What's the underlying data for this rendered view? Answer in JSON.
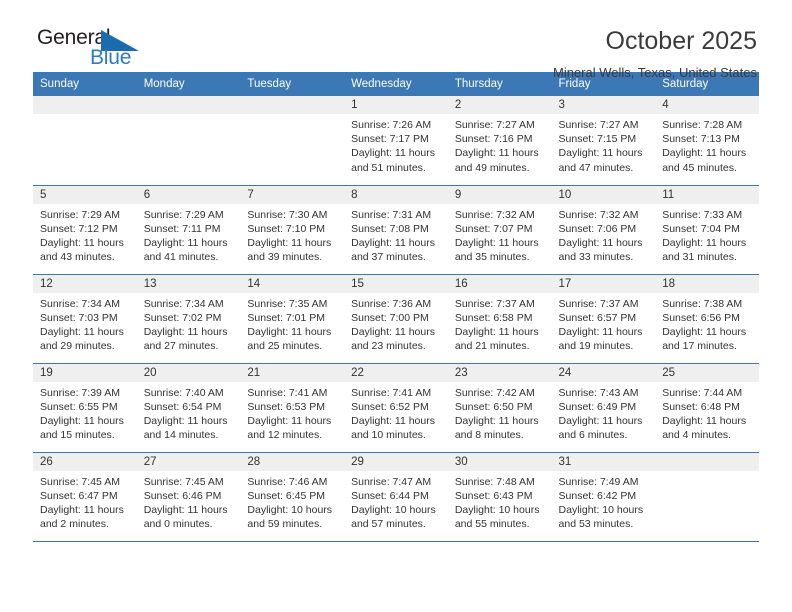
{
  "brand": {
    "name_part1": "General",
    "name_part2": "Blue",
    "triangle_color": "#1a6bb0",
    "text_color": "#231f20",
    "blue_color": "#2b7cc4"
  },
  "header": {
    "title": "October 2025",
    "subtitle": "Mineral Wells, Texas, United States",
    "accent_color": "#3b78b5",
    "daynum_band_color": "#efefef"
  },
  "weekdays": [
    "Sunday",
    "Monday",
    "Tuesday",
    "Wednesday",
    "Thursday",
    "Friday",
    "Saturday"
  ],
  "labels": {
    "sunrise": "Sunrise:",
    "sunset": "Sunset:",
    "daylight": "Daylight:"
  },
  "weeks": [
    [
      {
        "day": "",
        "sunrise": "",
        "sunset": "",
        "daylight": ""
      },
      {
        "day": "",
        "sunrise": "",
        "sunset": "",
        "daylight": ""
      },
      {
        "day": "",
        "sunrise": "",
        "sunset": "",
        "daylight": ""
      },
      {
        "day": "1",
        "sunrise": "Sunrise: 7:26 AM",
        "sunset": "Sunset: 7:17 PM",
        "daylight": "Daylight: 11 hours and 51 minutes."
      },
      {
        "day": "2",
        "sunrise": "Sunrise: 7:27 AM",
        "sunset": "Sunset: 7:16 PM",
        "daylight": "Daylight: 11 hours and 49 minutes."
      },
      {
        "day": "3",
        "sunrise": "Sunrise: 7:27 AM",
        "sunset": "Sunset: 7:15 PM",
        "daylight": "Daylight: 11 hours and 47 minutes."
      },
      {
        "day": "4",
        "sunrise": "Sunrise: 7:28 AM",
        "sunset": "Sunset: 7:13 PM",
        "daylight": "Daylight: 11 hours and 45 minutes."
      }
    ],
    [
      {
        "day": "5",
        "sunrise": "Sunrise: 7:29 AM",
        "sunset": "Sunset: 7:12 PM",
        "daylight": "Daylight: 11 hours and 43 minutes."
      },
      {
        "day": "6",
        "sunrise": "Sunrise: 7:29 AM",
        "sunset": "Sunset: 7:11 PM",
        "daylight": "Daylight: 11 hours and 41 minutes."
      },
      {
        "day": "7",
        "sunrise": "Sunrise: 7:30 AM",
        "sunset": "Sunset: 7:10 PM",
        "daylight": "Daylight: 11 hours and 39 minutes."
      },
      {
        "day": "8",
        "sunrise": "Sunrise: 7:31 AM",
        "sunset": "Sunset: 7:08 PM",
        "daylight": "Daylight: 11 hours and 37 minutes."
      },
      {
        "day": "9",
        "sunrise": "Sunrise: 7:32 AM",
        "sunset": "Sunset: 7:07 PM",
        "daylight": "Daylight: 11 hours and 35 minutes."
      },
      {
        "day": "10",
        "sunrise": "Sunrise: 7:32 AM",
        "sunset": "Sunset: 7:06 PM",
        "daylight": "Daylight: 11 hours and 33 minutes."
      },
      {
        "day": "11",
        "sunrise": "Sunrise: 7:33 AM",
        "sunset": "Sunset: 7:04 PM",
        "daylight": "Daylight: 11 hours and 31 minutes."
      }
    ],
    [
      {
        "day": "12",
        "sunrise": "Sunrise: 7:34 AM",
        "sunset": "Sunset: 7:03 PM",
        "daylight": "Daylight: 11 hours and 29 minutes."
      },
      {
        "day": "13",
        "sunrise": "Sunrise: 7:34 AM",
        "sunset": "Sunset: 7:02 PM",
        "daylight": "Daylight: 11 hours and 27 minutes."
      },
      {
        "day": "14",
        "sunrise": "Sunrise: 7:35 AM",
        "sunset": "Sunset: 7:01 PM",
        "daylight": "Daylight: 11 hours and 25 minutes."
      },
      {
        "day": "15",
        "sunrise": "Sunrise: 7:36 AM",
        "sunset": "Sunset: 7:00 PM",
        "daylight": "Daylight: 11 hours and 23 minutes."
      },
      {
        "day": "16",
        "sunrise": "Sunrise: 7:37 AM",
        "sunset": "Sunset: 6:58 PM",
        "daylight": "Daylight: 11 hours and 21 minutes."
      },
      {
        "day": "17",
        "sunrise": "Sunrise: 7:37 AM",
        "sunset": "Sunset: 6:57 PM",
        "daylight": "Daylight: 11 hours and 19 minutes."
      },
      {
        "day": "18",
        "sunrise": "Sunrise: 7:38 AM",
        "sunset": "Sunset: 6:56 PM",
        "daylight": "Daylight: 11 hours and 17 minutes."
      }
    ],
    [
      {
        "day": "19",
        "sunrise": "Sunrise: 7:39 AM",
        "sunset": "Sunset: 6:55 PM",
        "daylight": "Daylight: 11 hours and 15 minutes."
      },
      {
        "day": "20",
        "sunrise": "Sunrise: 7:40 AM",
        "sunset": "Sunset: 6:54 PM",
        "daylight": "Daylight: 11 hours and 14 minutes."
      },
      {
        "day": "21",
        "sunrise": "Sunrise: 7:41 AM",
        "sunset": "Sunset: 6:53 PM",
        "daylight": "Daylight: 11 hours and 12 minutes."
      },
      {
        "day": "22",
        "sunrise": "Sunrise: 7:41 AM",
        "sunset": "Sunset: 6:52 PM",
        "daylight": "Daylight: 11 hours and 10 minutes."
      },
      {
        "day": "23",
        "sunrise": "Sunrise: 7:42 AM",
        "sunset": "Sunset: 6:50 PM",
        "daylight": "Daylight: 11 hours and 8 minutes."
      },
      {
        "day": "24",
        "sunrise": "Sunrise: 7:43 AM",
        "sunset": "Sunset: 6:49 PM",
        "daylight": "Daylight: 11 hours and 6 minutes."
      },
      {
        "day": "25",
        "sunrise": "Sunrise: 7:44 AM",
        "sunset": "Sunset: 6:48 PM",
        "daylight": "Daylight: 11 hours and 4 minutes."
      }
    ],
    [
      {
        "day": "26",
        "sunrise": "Sunrise: 7:45 AM",
        "sunset": "Sunset: 6:47 PM",
        "daylight": "Daylight: 11 hours and 2 minutes."
      },
      {
        "day": "27",
        "sunrise": "Sunrise: 7:45 AM",
        "sunset": "Sunset: 6:46 PM",
        "daylight": "Daylight: 11 hours and 0 minutes."
      },
      {
        "day": "28",
        "sunrise": "Sunrise: 7:46 AM",
        "sunset": "Sunset: 6:45 PM",
        "daylight": "Daylight: 10 hours and 59 minutes."
      },
      {
        "day": "29",
        "sunrise": "Sunrise: 7:47 AM",
        "sunset": "Sunset: 6:44 PM",
        "daylight": "Daylight: 10 hours and 57 minutes."
      },
      {
        "day": "30",
        "sunrise": "Sunrise: 7:48 AM",
        "sunset": "Sunset: 6:43 PM",
        "daylight": "Daylight: 10 hours and 55 minutes."
      },
      {
        "day": "31",
        "sunrise": "Sunrise: 7:49 AM",
        "sunset": "Sunset: 6:42 PM",
        "daylight": "Daylight: 10 hours and 53 minutes."
      },
      {
        "day": "",
        "sunrise": "",
        "sunset": "",
        "daylight": ""
      }
    ]
  ]
}
